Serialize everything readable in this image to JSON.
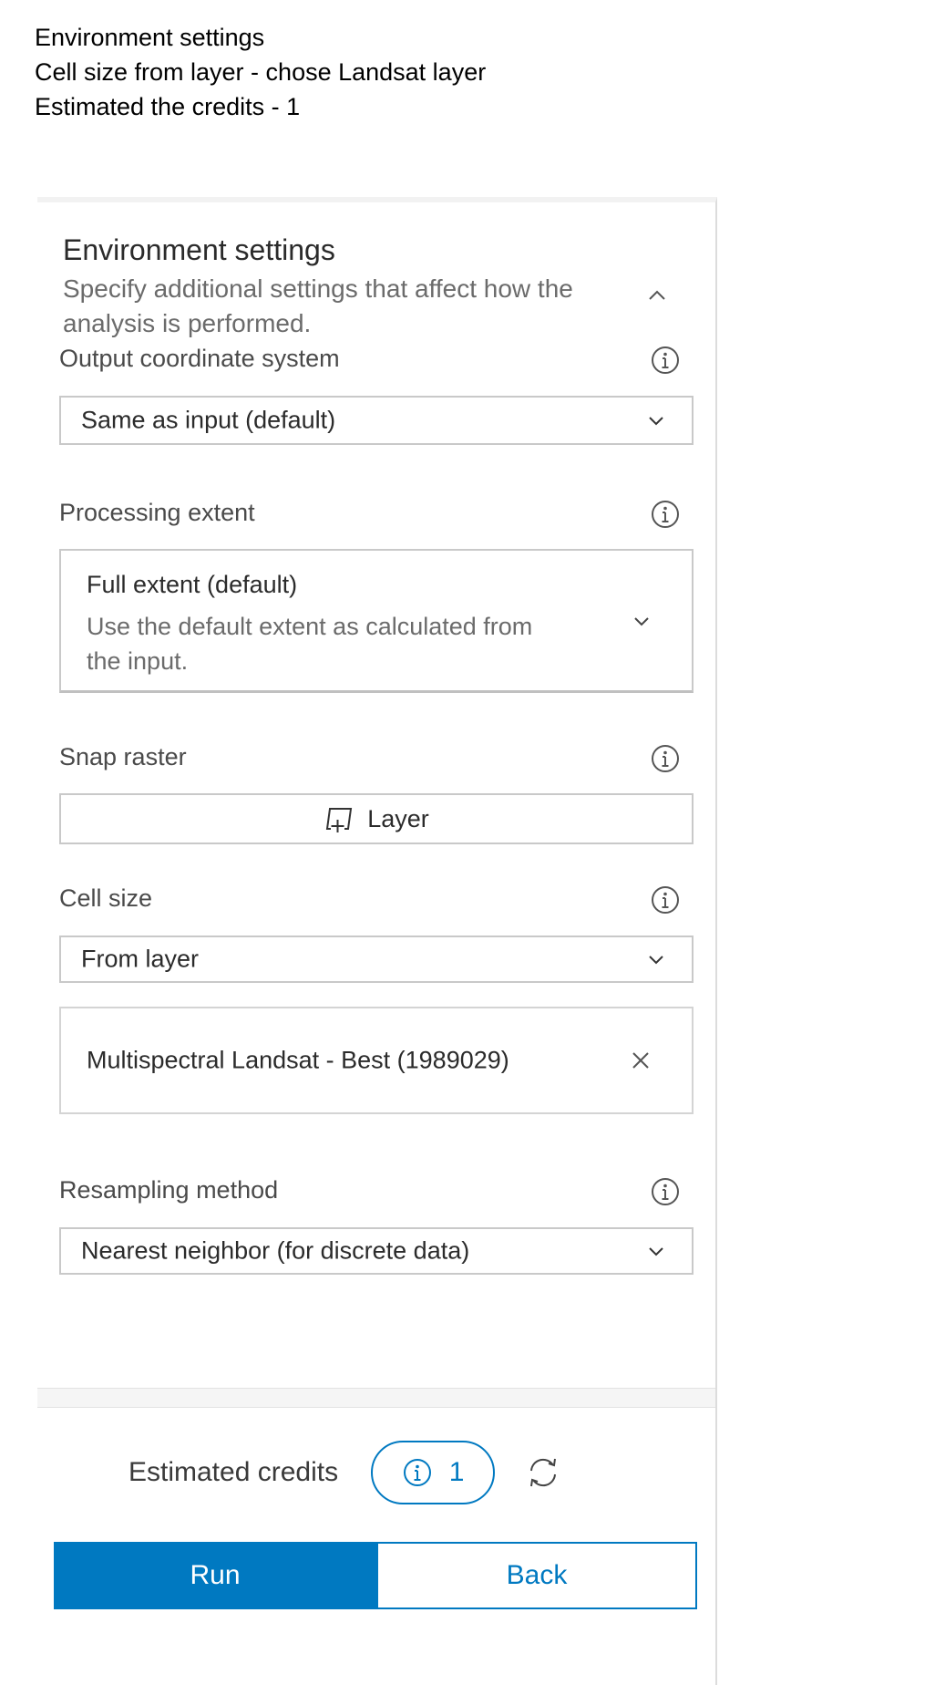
{
  "caption": {
    "line1": "Environment settings",
    "line2": "Cell size from layer - chose Landsat layer",
    "line3": "Estimated the credits - 1"
  },
  "section": {
    "title": "Environment settings",
    "description": "Specify additional settings that affect how the analysis is performed.",
    "collapse_icon": "chevron-up-icon"
  },
  "fields": {
    "output_coordinate_system": {
      "label": "Output coordinate system",
      "value": "Same as input (default)"
    },
    "processing_extent": {
      "label": "Processing extent",
      "title": "Full extent (default)",
      "description": "Use the default extent as calculated from the input."
    },
    "snap_raster": {
      "label": "Snap raster",
      "button_label": "Layer"
    },
    "cell_size": {
      "label": "Cell size",
      "value": "From layer",
      "chosen_layer": "Multispectral Landsat - Best (1989029)"
    },
    "resampling_method": {
      "label": "Resampling method",
      "value": "Nearest neighbor (for discrete data)"
    }
  },
  "footer": {
    "credits_label": "Estimated credits",
    "credits_value": "1",
    "run_label": "Run",
    "back_label": "Back"
  },
  "colors": {
    "accent": "#0079c1",
    "border": "#c9c9c9",
    "text": "#2b2b2b",
    "muted": "#6b6b6b"
  }
}
